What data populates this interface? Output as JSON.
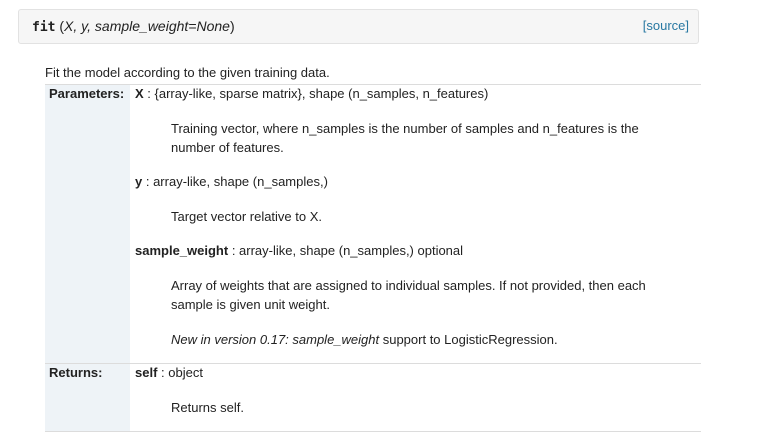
{
  "signature": {
    "name": "fit",
    "open_paren": " (",
    "params": "X, y, sample_weight=None",
    "close_paren": ")",
    "source_label": "[source]"
  },
  "description": "Fit the model according to the given training data.",
  "parameters": {
    "label": "Parameters:",
    "items": [
      {
        "name": "X",
        "type": " : {array-like, sparse matrix}, shape (n_samples, n_features)",
        "desc_line1": "Training vector, where n_samples is the number of samples and n_features is the",
        "desc_line2": "number of features."
      },
      {
        "name": "y",
        "type": " : array-like, shape (n_samples,)",
        "desc_line1": "Target vector relative to X."
      },
      {
        "name": "sample_weight",
        "type": " : array-like, shape (n_samples,) optional",
        "desc_line1": "Array of weights that are assigned to individual samples. If not provided, then each",
        "desc_line2": "sample is given unit weight.",
        "versionadded_italic": "New in version 0.17: sample_weight",
        "versionadded_rest": " support to LogisticRegression."
      }
    ]
  },
  "returns": {
    "label": "Returns:",
    "name": "self",
    "type": " : object",
    "desc": "Returns self."
  }
}
